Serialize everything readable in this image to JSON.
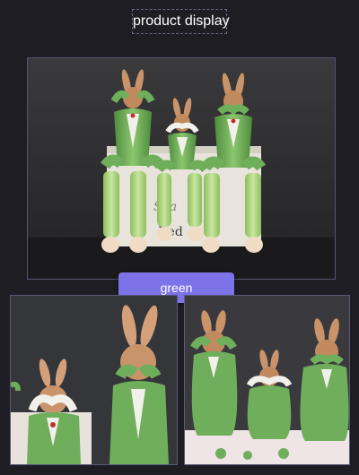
{
  "header": {
    "title": "product display"
  },
  "product": {
    "selected_color": "green",
    "accent_color": "#7d73e8",
    "figure_color": "#6fae5a"
  },
  "gallery": {
    "main_image": "three-rabbit-figurines-sitting-on-book",
    "thumbnails": [
      "rabbit-figurines-closeup-left",
      "rabbit-figurines-closeup-right"
    ]
  }
}
